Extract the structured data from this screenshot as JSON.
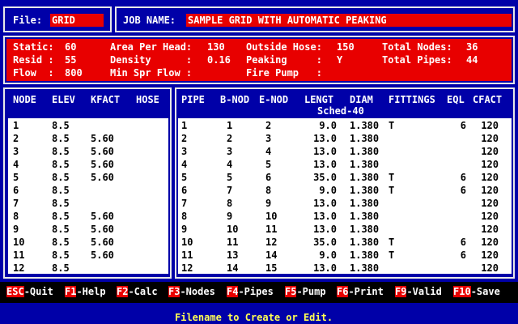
{
  "header": {
    "file_label": "File:",
    "file_value": "GRID",
    "job_label": "JOB NAME:",
    "job_value": "SAMPLE GRID WITH AUTOMATIC PEAKING"
  },
  "summary": {
    "static_label": "Static:",
    "static_value": "60",
    "resid_label": "Resid :",
    "resid_value": "55",
    "flow_label": "Flow  :",
    "flow_value": "800",
    "area_label": "Area Per Head:",
    "area_value": "130",
    "density_label": "Density      :",
    "density_value": "0.16",
    "minspr_label": "Min Spr Flow :",
    "minspr_value": "",
    "outside_label": "Outside Hose:",
    "outside_value": "150",
    "peaking_label": "Peaking     :",
    "peaking_value": "Y",
    "firepump_label": "Fire Pump   :",
    "firepump_value": "",
    "nodes_label": "Total Nodes:",
    "nodes_value": "36",
    "pipes_label": "Total Pipes:",
    "pipes_value": "44"
  },
  "nodes_table": {
    "headers": [
      "NODE",
      "ELEV",
      "KFACT",
      "HOSE"
    ],
    "rows": [
      [
        "1",
        "8.5",
        "",
        ""
      ],
      [
        "2",
        "8.5",
        "5.60",
        ""
      ],
      [
        "3",
        "8.5",
        "5.60",
        ""
      ],
      [
        "4",
        "8.5",
        "5.60",
        ""
      ],
      [
        "5",
        "8.5",
        "5.60",
        ""
      ],
      [
        "6",
        "8.5",
        "",
        ""
      ],
      [
        "7",
        "8.5",
        "",
        ""
      ],
      [
        "8",
        "8.5",
        "5.60",
        ""
      ],
      [
        "9",
        "8.5",
        "5.60",
        ""
      ],
      [
        "10",
        "8.5",
        "5.60",
        ""
      ],
      [
        "11",
        "8.5",
        "5.60",
        ""
      ],
      [
        "12",
        "8.5",
        "",
        ""
      ]
    ]
  },
  "pipes_table": {
    "headers": [
      "PIPE",
      "B-NOD",
      "E-NOD",
      "LENGT",
      "DIAM",
      "FITTINGS",
      "EQL",
      "CFACT"
    ],
    "sched_label": "Sched-40",
    "rows": [
      [
        "1",
        "1",
        "2",
        "9.0",
        "1.380",
        "T",
        "6",
        "120"
      ],
      [
        "2",
        "2",
        "3",
        "13.0",
        "1.380",
        "",
        "",
        "120"
      ],
      [
        "3",
        "3",
        "4",
        "13.0",
        "1.380",
        "",
        "",
        "120"
      ],
      [
        "4",
        "4",
        "5",
        "13.0",
        "1.380",
        "",
        "",
        "120"
      ],
      [
        "5",
        "5",
        "6",
        "35.0",
        "1.380",
        "T",
        "6",
        "120"
      ],
      [
        "6",
        "7",
        "8",
        "9.0",
        "1.380",
        "T",
        "6",
        "120"
      ],
      [
        "7",
        "8",
        "9",
        "13.0",
        "1.380",
        "",
        "",
        "120"
      ],
      [
        "8",
        "9",
        "10",
        "13.0",
        "1.380",
        "",
        "",
        "120"
      ],
      [
        "9",
        "10",
        "11",
        "13.0",
        "1.380",
        "",
        "",
        "120"
      ],
      [
        "10",
        "11",
        "12",
        "35.0",
        "1.380",
        "T",
        "6",
        "120"
      ],
      [
        "11",
        "13",
        "14",
        "9.0",
        "1.380",
        "T",
        "6",
        "120"
      ],
      [
        "12",
        "14",
        "15",
        "13.0",
        "1.380",
        "",
        "",
        "120"
      ]
    ]
  },
  "fkeys": [
    {
      "key": "ESC",
      "label": "-Quit"
    },
    {
      "key": "F1",
      "label": "-Help"
    },
    {
      "key": "F2",
      "label": "-Calc"
    },
    {
      "key": "F3",
      "label": "-Nodes"
    },
    {
      "key": "F4",
      "label": "-Pipes"
    },
    {
      "key": "F5",
      "label": "-Pump"
    },
    {
      "key": "F6",
      "label": "-Print"
    },
    {
      "key": "F9",
      "label": "-Valid"
    },
    {
      "key": "F10",
      "label": "-Save"
    }
  ],
  "status_line": "Filename to Create or Edit.",
  "colors": {
    "background": "#0000a8",
    "field_red": "#e80000",
    "border": "#e8e8e8",
    "status_yellow": "#ffff54"
  }
}
